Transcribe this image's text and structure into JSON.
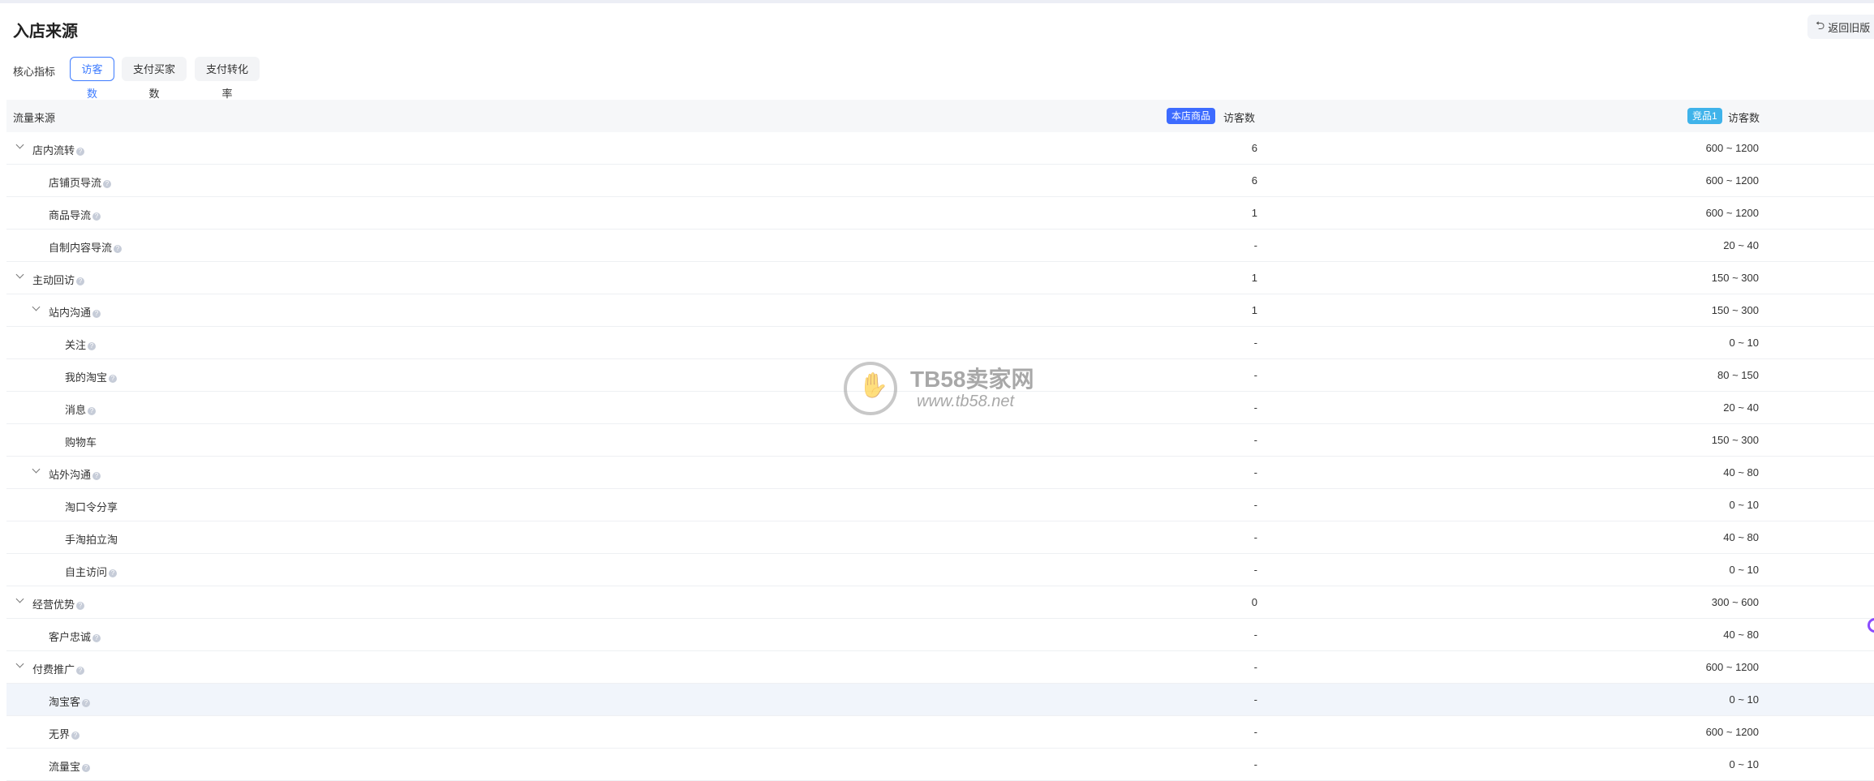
{
  "page": {
    "title": "入店来源",
    "back_label": "返回旧版"
  },
  "metrics": {
    "label": "核心指标",
    "tabs": [
      "访客数",
      "支付买家数",
      "支付转化率"
    ],
    "active_index": 0
  },
  "table": {
    "header": {
      "source": "流量来源",
      "own_badge": "本店商品",
      "own_metric": "访客数",
      "comp_badge": "竞品1",
      "comp_metric": "访客数"
    },
    "rows": [
      {
        "label": "店内流转",
        "level": 0,
        "expand": true,
        "help": true,
        "v1": "6",
        "v2": "600 ~ 1200"
      },
      {
        "label": "店铺页导流",
        "level": 1,
        "expand": false,
        "help": true,
        "v1": "6",
        "v2": "600 ~ 1200"
      },
      {
        "label": "商品导流",
        "level": 1,
        "expand": false,
        "help": true,
        "v1": "1",
        "v2": "600 ~ 1200"
      },
      {
        "label": "自制内容导流",
        "level": 1,
        "expand": false,
        "help": true,
        "v1": "-",
        "v2": "20 ~ 40"
      },
      {
        "label": "主动回访",
        "level": 0,
        "expand": true,
        "help": true,
        "v1": "1",
        "v2": "150 ~ 300"
      },
      {
        "label": "站内沟通",
        "level": 1,
        "expand": true,
        "help": true,
        "v1": "1",
        "v2": "150 ~ 300"
      },
      {
        "label": "关注",
        "level": 2,
        "expand": false,
        "help": true,
        "v1": "-",
        "v2": "0 ~ 10"
      },
      {
        "label": "我的淘宝",
        "level": 2,
        "expand": false,
        "help": true,
        "v1": "-",
        "v2": "80 ~ 150"
      },
      {
        "label": "消息",
        "level": 2,
        "expand": false,
        "help": true,
        "v1": "-",
        "v2": "20 ~ 40"
      },
      {
        "label": "购物车",
        "level": 2,
        "expand": false,
        "help": false,
        "v1": "-",
        "v2": "150 ~ 300"
      },
      {
        "label": "站外沟通",
        "level": 1,
        "expand": true,
        "help": true,
        "v1": "-",
        "v2": "40 ~ 80"
      },
      {
        "label": "淘口令分享",
        "level": 2,
        "expand": false,
        "help": false,
        "v1": "-",
        "v2": "0 ~ 10"
      },
      {
        "label": "手淘拍立淘",
        "level": 2,
        "expand": false,
        "help": false,
        "v1": "-",
        "v2": "40 ~ 80"
      },
      {
        "label": "自主访问",
        "level": 2,
        "expand": false,
        "help": true,
        "v1": "-",
        "v2": "0 ~ 10"
      },
      {
        "label": "经营优势",
        "level": 0,
        "expand": true,
        "help": true,
        "v1": "0",
        "v2": "300 ~ 600"
      },
      {
        "label": "客户忠诚",
        "level": 1,
        "expand": false,
        "help": true,
        "v1": "-",
        "v2": "40 ~ 80"
      },
      {
        "label": "付费推广",
        "level": 0,
        "expand": true,
        "help": true,
        "v1": "-",
        "v2": "600 ~ 1200"
      },
      {
        "label": "淘宝客",
        "level": 1,
        "expand": false,
        "help": true,
        "v1": "-",
        "v2": "0 ~ 10",
        "highlight": true
      },
      {
        "label": "无界",
        "level": 1,
        "expand": false,
        "help": true,
        "v1": "-",
        "v2": "600 ~ 1200"
      },
      {
        "label": "流量宝",
        "level": 1,
        "expand": false,
        "help": true,
        "v1": "-",
        "v2": "0 ~ 10"
      }
    ]
  },
  "watermark": {
    "name": "TB58卖家网",
    "url": "www.tb58.net"
  },
  "colors": {
    "accent": "#3d7bff",
    "own_badge": "#3d6bff",
    "comp_badge": "#3fb3ea",
    "row_highlight": "#f1f5fb"
  }
}
